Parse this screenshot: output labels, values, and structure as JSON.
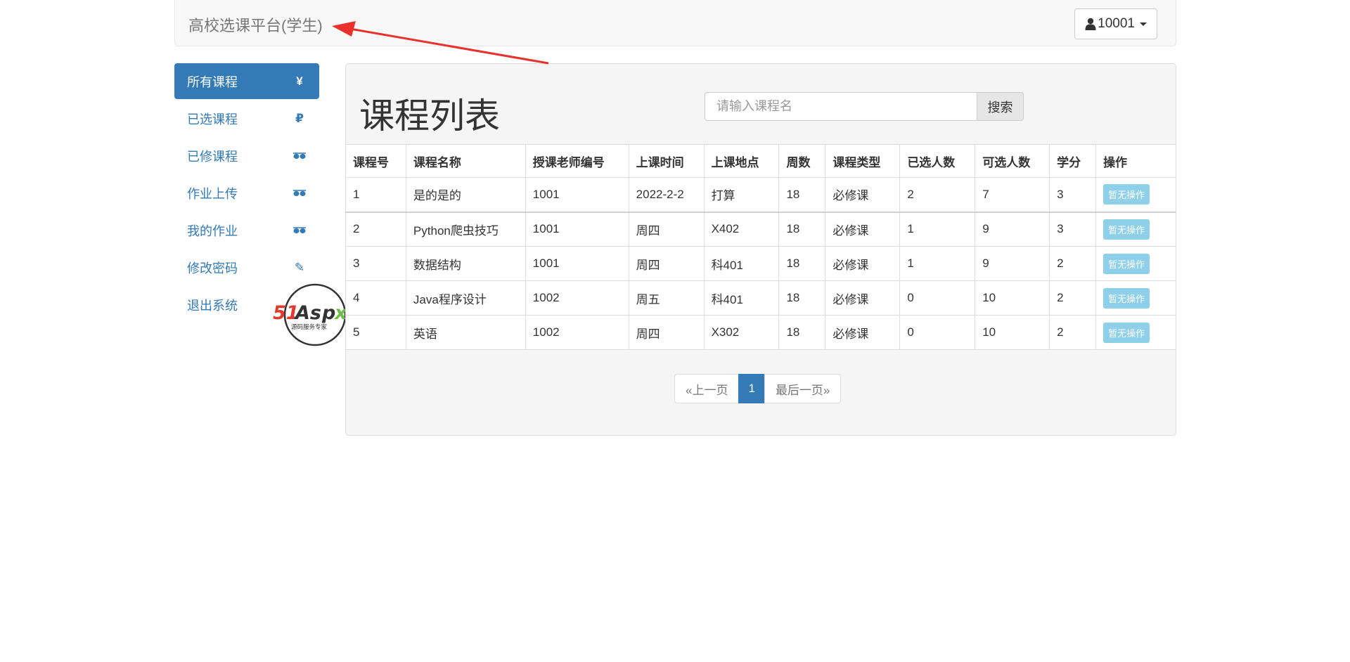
{
  "navbar": {
    "brand": "高校选课平台(学生)",
    "user_label": "10001"
  },
  "sidebar": {
    "items": [
      {
        "label": "所有课程",
        "icon": "yen-icon",
        "glyph": "¥"
      },
      {
        "label": "已选课程",
        "icon": "ruble-icon",
        "glyph": "₽"
      },
      {
        "label": "已修课程",
        "icon": "sunglasses-icon",
        "glyph": ""
      },
      {
        "label": "作业上传",
        "icon": "sunglasses-icon",
        "glyph": ""
      },
      {
        "label": "我的作业",
        "icon": "sunglasses-icon",
        "glyph": ""
      },
      {
        "label": "修改密码",
        "icon": "pencil-icon",
        "glyph": "✎"
      },
      {
        "label": "退出系统",
        "icon": "log-out-icon",
        "glyph": ""
      }
    ]
  },
  "main": {
    "title": "课程列表",
    "search_placeholder": "请输入课程名",
    "search_button": "搜索"
  },
  "table": {
    "headers": [
      "课程号",
      "课程名称",
      "授课老师编号",
      "上课时间",
      "上课地点",
      "周数",
      "课程类型",
      "已选人数",
      "可选人数",
      "学分",
      "操作"
    ],
    "rows": [
      [
        "1",
        "是的是的",
        "1001",
        "2022-2-2",
        "打算",
        "18",
        "必修课",
        "2",
        "7",
        "3",
        "暂无操作"
      ],
      [
        "2",
        "Python爬虫技巧",
        "1001",
        "周四",
        "X402",
        "18",
        "必修课",
        "1",
        "9",
        "3",
        "暂无操作"
      ],
      [
        "3",
        "数据结构",
        "1001",
        "周四",
        "科401",
        "18",
        "必修课",
        "1",
        "9",
        "2",
        "暂无操作"
      ],
      [
        "4",
        "Java程序设计",
        "1002",
        "周五",
        "科401",
        "18",
        "必修课",
        "0",
        "10",
        "2",
        "暂无操作"
      ],
      [
        "5",
        "英语",
        "1002",
        "周四",
        "X302",
        "18",
        "必修课",
        "0",
        "10",
        "2",
        "暂无操作"
      ]
    ]
  },
  "pagination": {
    "prev": "«上一页",
    "current": "1",
    "last": "最后一页»"
  },
  "watermark": {
    "brand": "51Aspx",
    "tagline": "源码服务专家"
  },
  "colors": {
    "primary": "#337ab7",
    "annotation_arrow": "#e8312a",
    "op_button": "#8ed0ea"
  }
}
